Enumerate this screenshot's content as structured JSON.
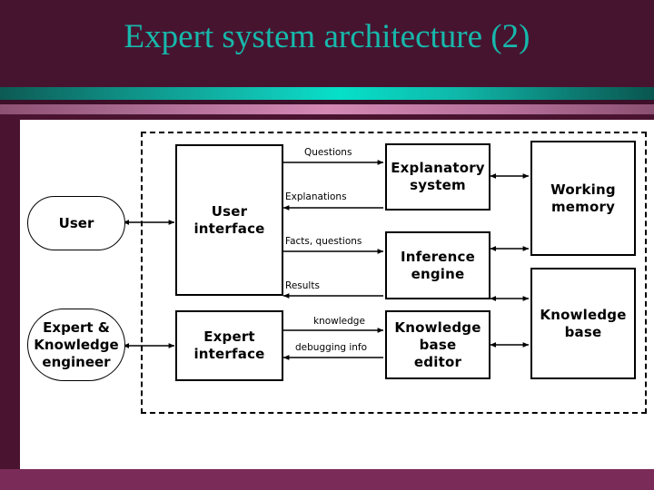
{
  "slide": {
    "title": "Expert system architecture (2)",
    "title_color": "#17b8ab",
    "background_color": "#471430",
    "canvas_color": "#ffffff",
    "footer_color": "#7a2b58",
    "accent_teal": "#06e0c9",
    "accent_pink": "#d488b5"
  },
  "diagram": {
    "type": "block-diagram",
    "boundary_label": "expert system boundary (dashed)",
    "nodes": [
      {
        "id": "user",
        "label": "User",
        "shape": "rounded"
      },
      {
        "id": "expert-engineer",
        "label": "Expert &\nKnowledge\nengineer",
        "shape": "rounded"
      },
      {
        "id": "user-interface",
        "label": "User\ninterface",
        "shape": "rect"
      },
      {
        "id": "expert-interface",
        "label": "Expert\ninterface",
        "shape": "rect"
      },
      {
        "id": "explanatory",
        "label": "Explanatory\nsystem",
        "shape": "rect"
      },
      {
        "id": "inference",
        "label": "Inference\nengine",
        "shape": "rect"
      },
      {
        "id": "kb-editor",
        "label": "Knowledge\nbase\neditor",
        "shape": "rect"
      },
      {
        "id": "working-memory",
        "label": "Working\nmemory",
        "shape": "rect"
      },
      {
        "id": "knowledge-base",
        "label": "Knowledge\nbase",
        "shape": "rect"
      }
    ],
    "edge_labels": {
      "questions": "Questions",
      "explanations": "Explanations",
      "facts_questions": "Facts, questions",
      "results": "Results",
      "knowledge": "knowledge",
      "debugging_info": "debugging info"
    },
    "node_labels": {
      "user": "User",
      "expert_engineer_l1": "Expert &",
      "expert_engineer_l2": "Knowledge",
      "expert_engineer_l3": "engineer",
      "user_interface_l1": "User",
      "user_interface_l2": "interface",
      "expert_interface_l1": "Expert",
      "expert_interface_l2": "interface",
      "explanatory_l1": "Explanatory",
      "explanatory_l2": "system",
      "inference_l1": "Inference",
      "inference_l2": "engine",
      "kb_editor_l1": "Knowledge",
      "kb_editor_l2": "base",
      "kb_editor_l3": "editor",
      "working_memory_l1": "Working",
      "working_memory_l2": "memory",
      "knowledge_base_l1": "Knowledge",
      "knowledge_base_l2": "base"
    }
  }
}
